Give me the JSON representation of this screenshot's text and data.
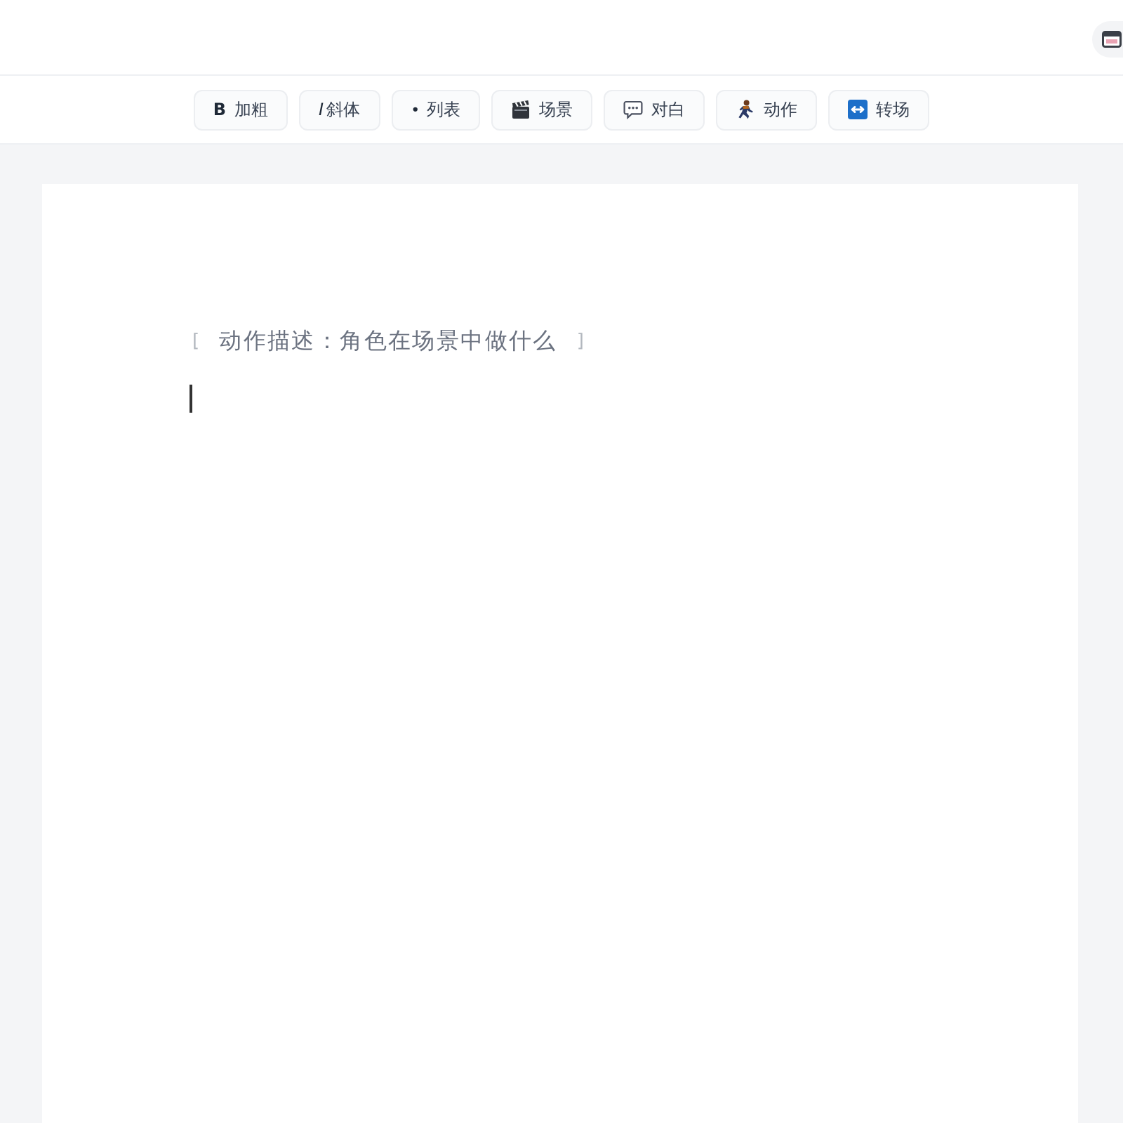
{
  "toolbar": {
    "buttons": [
      {
        "kind": "bold",
        "icon": "B",
        "label": "加粗"
      },
      {
        "kind": "italic",
        "icon": "I",
        "label": "斜体"
      },
      {
        "kind": "list",
        "icon": "•",
        "label": "列表"
      },
      {
        "kind": "scene",
        "label": "场景"
      },
      {
        "kind": "dialogue",
        "label": "对白"
      },
      {
        "kind": "action",
        "label": "动作"
      },
      {
        "kind": "transition",
        "label": "转场"
      }
    ]
  },
  "editor": {
    "action_line": {
      "open_mark": "[",
      "text": "动作描述：角色在场景中做什么",
      "close_mark": "]"
    }
  }
}
